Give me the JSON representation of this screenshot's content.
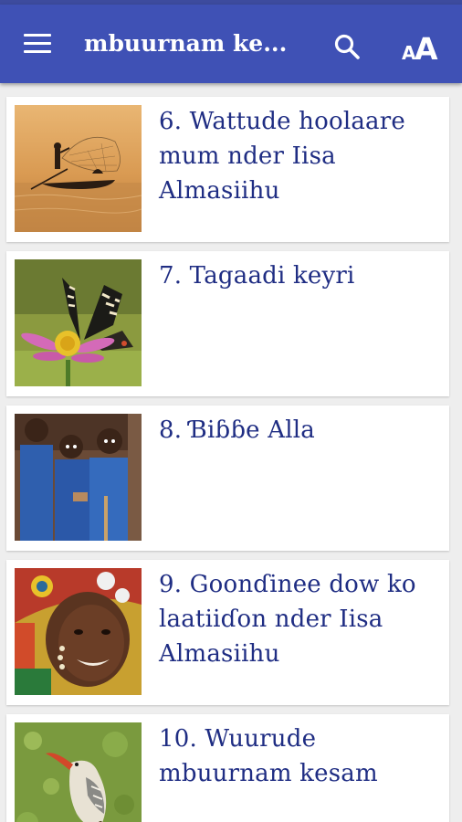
{
  "appbar": {
    "title": "mbuurnam ke...",
    "menu_icon": "hamburger-menu-icon",
    "search_icon": "search-icon",
    "font_size_icon": "font-size-icon"
  },
  "colors": {
    "appbar": "#3f51b5",
    "title_text": "#1f2d83",
    "background": "#eeeeee",
    "card": "#ffffff"
  },
  "items": [
    {
      "title": "6. Wattude hoolaare mum nder Iisa Almasiihu",
      "image": "fisherman-casting-net-photo"
    },
    {
      "title": "7. Tagaadi keyri",
      "image": "butterfly-on-flower-photo"
    },
    {
      "title": "8. Ɓiɓɓe Alla",
      "image": "children-in-blue-photo"
    },
    {
      "title": "9. Goonɗinee dow ko laatiiɗon nder Iisa Almasiihu",
      "image": "smiling-child-photo"
    },
    {
      "title": "10. Wuurude mbuurnam kesam",
      "image": "hornbill-bird-photo"
    }
  ]
}
